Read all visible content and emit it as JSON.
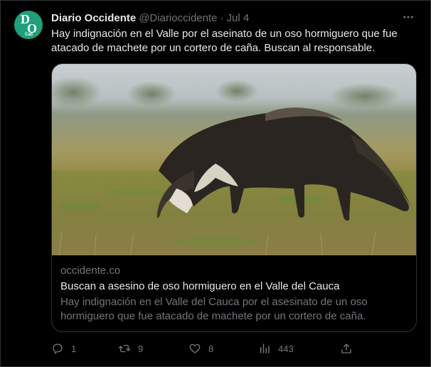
{
  "tweet": {
    "author_name": "Diario Occidente",
    "handle": "@Diarioccidente",
    "separator": "·",
    "date": "Jul 4",
    "more_icon": "ellipsis-icon",
    "text": "Hay indignación en el Valle por el aseinato de un oso hormiguero que fue atacado de machete por un cortero de caña. Buscan al responsable.",
    "avatar": {
      "logo_text_1": "D",
      "logo_text_2": "O",
      "logo_text_3": "Cali",
      "color": "#1fa07a"
    }
  },
  "card": {
    "domain": "occidente.co",
    "title": "Buscan a asesino de oso hormiguero en el Valle del Cauca",
    "description": "Hay indignación en el Valle del Cauca por el asesinato de un oso hormiguero que fue atacado de machete por un cortero de caña."
  },
  "actions": {
    "replies": {
      "icon": "reply-icon",
      "count": "1"
    },
    "retweets": {
      "icon": "retweet-icon",
      "count": "9"
    },
    "likes": {
      "icon": "heart-icon",
      "count": "8"
    },
    "views": {
      "icon": "views-icon",
      "count": "443"
    },
    "share": {
      "icon": "share-icon"
    }
  },
  "colors": {
    "background": "#000000",
    "text_primary": "#e7e9ea",
    "text_secondary": "#71767b",
    "border": "#2f3336"
  }
}
